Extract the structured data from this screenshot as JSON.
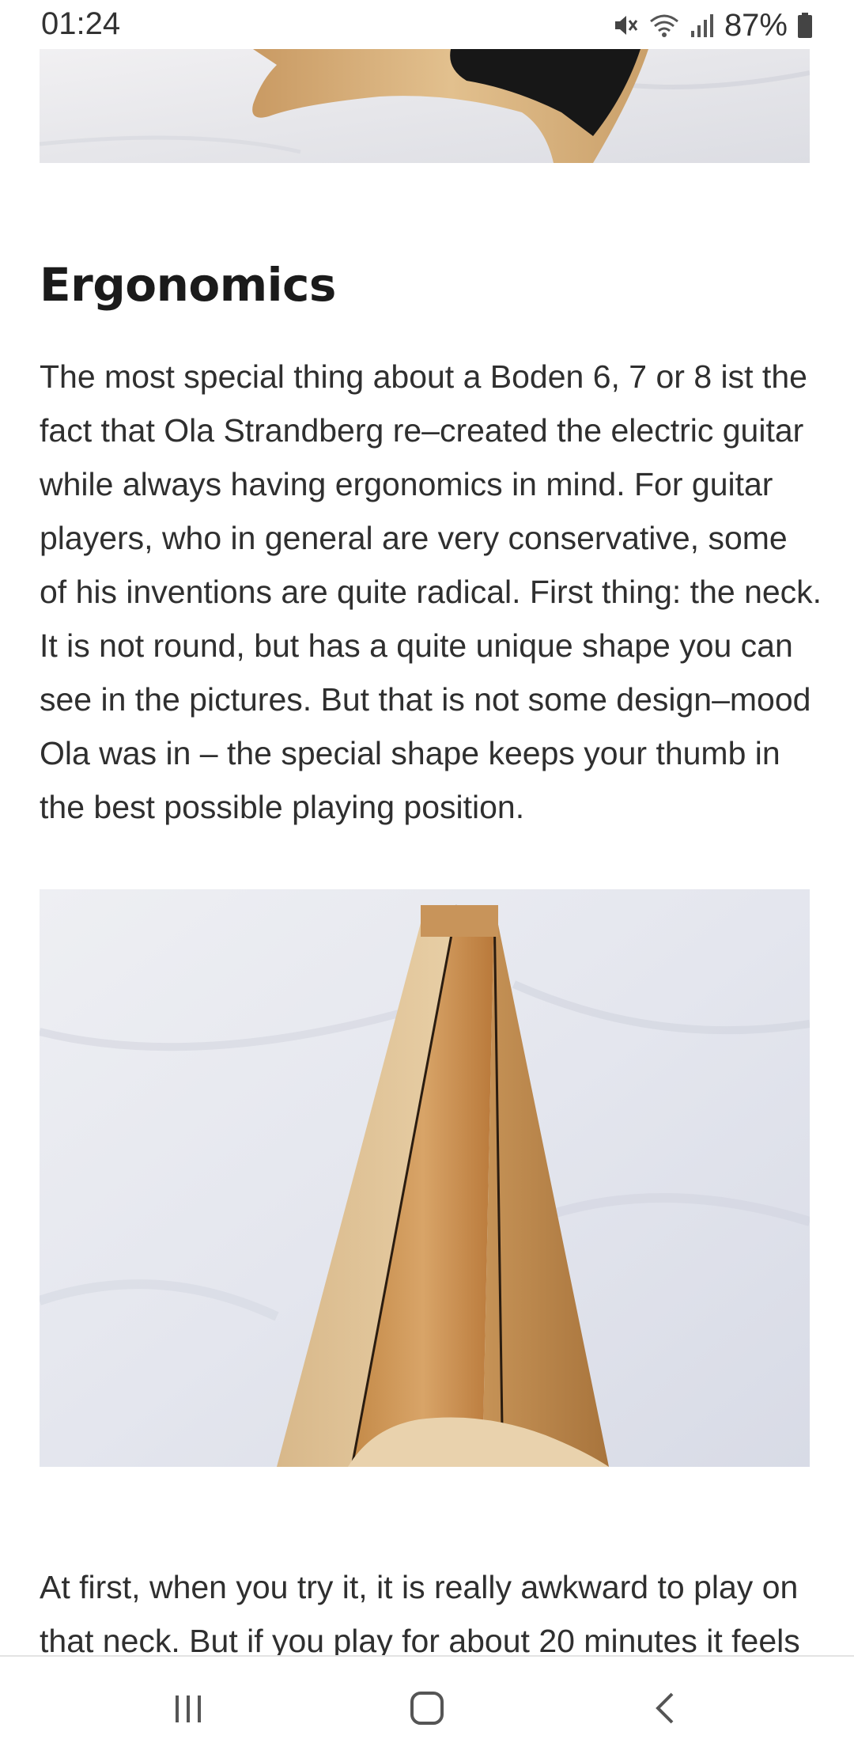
{
  "status_bar": {
    "time": "01:24",
    "battery_percent": "87%",
    "icons": [
      "mute-icon",
      "wifi-icon",
      "signal-icon",
      "battery-icon"
    ]
  },
  "article": {
    "heading": "Ergonomics",
    "paragraph_1": "The most special thing about a Boden 6, 7 or 8 ist the fact that Ola Strandberg re–created the electric guitar while always having ergonomics in mind. For guitar players, who in general are very conservative, some of his inventions are quite radical. First thing: the neck. It is not round, but has a quite unique shape you can see in the pictures. But that is not some design–mood Ola was in – the special shape keeps your thumb in the best possible playing position.",
    "paragraph_2": "At first, when you try it, it is really awkward to play on that neck. But if you play for about 20 minutes it feels"
  },
  "nav_bar": {
    "icons": [
      "recents-icon",
      "home-icon",
      "back-icon"
    ]
  }
}
